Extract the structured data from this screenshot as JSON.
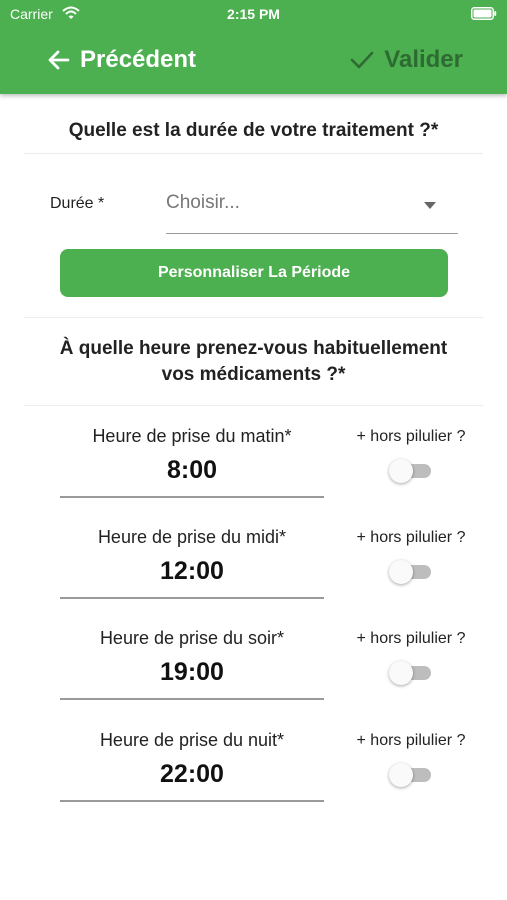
{
  "status_bar": {
    "carrier": "Carrier",
    "time": "2:15 PM"
  },
  "app_bar": {
    "back_label": "Précédent",
    "validate_label": "Valider",
    "colors": {
      "background": "#4caf50",
      "validate_text": "#2e6b32"
    }
  },
  "duration_section": {
    "title": "Quelle est la durée de votre traitement ?*",
    "field_label": "Durée *",
    "select_placeholder": "Choisir...",
    "custom_button_label": "Personnaliser La Période"
  },
  "intake_section": {
    "title_line1": "À quelle heure prenez-vous habituellement",
    "title_line2": "vos médicaments ?*",
    "rows": [
      {
        "label": "Heure de prise du matin*",
        "time": "8:00",
        "pill_label": "+ hors pilulier ?",
        "toggle_on": false
      },
      {
        "label": "Heure de prise du midi*",
        "time": "12:00",
        "pill_label": "+ hors pilulier ?",
        "toggle_on": false
      },
      {
        "label": "Heure de prise du soir*",
        "time": "19:00",
        "pill_label": "+ hors pilulier ?",
        "toggle_on": false
      },
      {
        "label": "Heure de prise du nuit*",
        "time": "22:00",
        "pill_label": "+ hors pilulier ?",
        "toggle_on": false
      }
    ]
  },
  "icons": [
    "wifi-icon",
    "battery-icon",
    "arrow-left-icon",
    "check-icon",
    "dropdown-icon"
  ]
}
